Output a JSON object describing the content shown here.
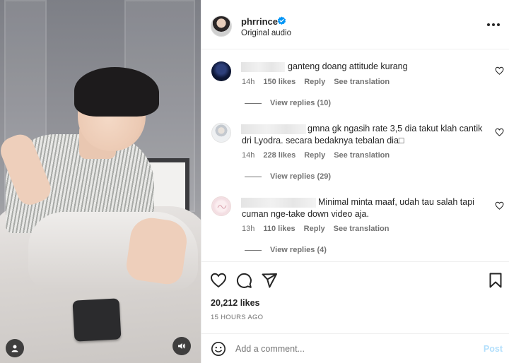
{
  "post": {
    "username": "phrrince",
    "audio": "Original audio",
    "likes": "20,212 likes",
    "timestamp": "15 HOURS AGO"
  },
  "comments": [
    {
      "text": "ganteng doang attitude kurang",
      "time": "14h",
      "likes": "150 likes",
      "reply": "Reply",
      "translate": "See translation",
      "view_replies": "View replies (10)"
    },
    {
      "text_line1": "gmna gk ngasih rate 3,5 dia takut klah cantik",
      "text_line2": "dri Lyodra. secara bedaknya tebalan dia□",
      "time": "14h",
      "likes": "228 likes",
      "reply": "Reply",
      "translate": "See translation",
      "view_replies": "View replies (29)"
    },
    {
      "text_line1": "Minimal minta maaf, udah tau salah tapi",
      "text_line2": "cuman nge-take down video aja.",
      "time": "13h",
      "likes": "110 likes",
      "reply": "Reply",
      "translate": "See translation",
      "view_replies": "View replies (4)"
    }
  ],
  "composer": {
    "placeholder": "Add a comment...",
    "post_label": "Post"
  },
  "icons": {
    "verified": "verified-badge-icon",
    "more": "more-options-icon",
    "like": "heart-icon",
    "comment": "comment-bubble-icon",
    "share": "paper-plane-icon",
    "save": "bookmark-icon",
    "emoji": "emoji-icon",
    "audio": "speaker-icon",
    "tag": "user-tag-icon"
  },
  "colors": {
    "verified": "#0095f6",
    "post_disabled": "#b2dffc",
    "secondary_text": "#737373"
  }
}
